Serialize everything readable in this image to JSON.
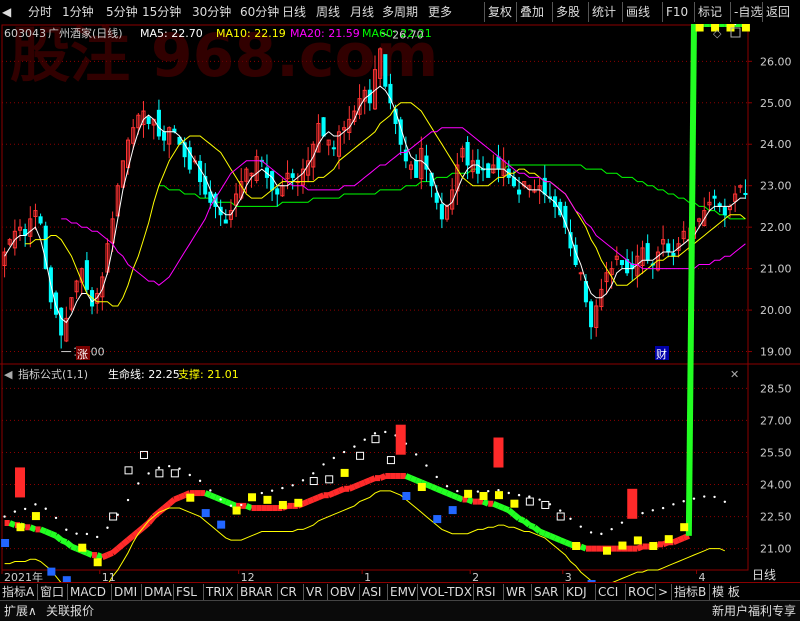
{
  "toolbar": {
    "left": [
      {
        "name": "back",
        "label": "◀"
      },
      {
        "name": "fenshi",
        "label": "分时"
      },
      {
        "name": "1min",
        "label": "1分钟"
      },
      {
        "name": "5min",
        "label": "5分钟"
      },
      {
        "name": "15min",
        "label": "15分钟"
      },
      {
        "name": "30min",
        "label": "30分钟"
      },
      {
        "name": "60min",
        "label": "60分钟"
      },
      {
        "name": "day",
        "label": "日线"
      },
      {
        "name": "week",
        "label": "周线"
      },
      {
        "name": "month",
        "label": "月线"
      },
      {
        "name": "multi",
        "label": "多周期"
      },
      {
        "name": "more",
        "label": "更多"
      }
    ],
    "right": [
      {
        "name": "restore",
        "label": "复权"
      },
      {
        "name": "overlay",
        "label": "叠加"
      },
      {
        "name": "multistock",
        "label": "多股"
      },
      {
        "name": "stats",
        "label": "统计"
      },
      {
        "name": "draw",
        "label": "画线"
      },
      {
        "name": "f10",
        "label": "F10"
      },
      {
        "name": "mark",
        "label": "标记"
      },
      {
        "name": "watch",
        "label": "-自选"
      },
      {
        "name": "return",
        "label": "返回"
      }
    ]
  },
  "watermark": "股注 968.com",
  "stock": {
    "code": "603043",
    "name": "广州酒家(日线)"
  },
  "ma_legend": [
    {
      "label": "MA5: 22.70",
      "color": "#ffffff"
    },
    {
      "label": "MA10: 22.19",
      "color": "#ffff00"
    },
    {
      "label": "MA20: 21.59",
      "color": "#ff00ff"
    },
    {
      "label": "MA60: 22.21",
      "color": "#00ff00"
    }
  ],
  "annotations": {
    "high": "26.70",
    "low": "19.00",
    "zhang": "涨",
    "cai": "财"
  },
  "indicator": {
    "name": "指标公式(1,1)",
    "line1": "生命线: 22.25",
    "line2": "支撑: 21.01"
  },
  "colors": {
    "up": "#ff3333",
    "down": "#00ffff",
    "ma5": "#ffffff",
    "ma10": "#ffff00",
    "ma20": "#ff00ff",
    "ma60": "#00ff00",
    "grid": "#8b0000",
    "axis": "#8b0000"
  },
  "chart_data": [
    {
      "type": "candlestick",
      "title": "603043 广州酒家(日线)",
      "y_ticks": [
        19.0,
        20.0,
        21.0,
        22.0,
        23.0,
        24.0,
        25.0,
        26.0
      ],
      "ylim": [
        18.7,
        26.9
      ],
      "x_labels": [
        "2021年",
        "11",
        "12",
        "1",
        "2",
        "3",
        "4"
      ],
      "x_label_index": [
        0,
        19,
        46,
        70,
        91,
        109,
        135
      ],
      "close": [
        21.4,
        21.7,
        21.9,
        22.0,
        21.8,
        22.2,
        22.4,
        22.1,
        21.0,
        20.2,
        19.9,
        19.4,
        19.8,
        20.3,
        20.7,
        21.0,
        20.5,
        20.1,
        20.4,
        20.8,
        21.6,
        22.2,
        23.0,
        23.6,
        24.1,
        24.4,
        24.7,
        24.8,
        24.5,
        24.6,
        24.2,
        24.1,
        24.4,
        24.3,
        24.0,
        23.7,
        23.4,
        23.6,
        23.1,
        22.8,
        22.6,
        22.5,
        22.3,
        22.1,
        22.4,
        22.8,
        23.1,
        23.4,
        23.3,
        23.7,
        23.6,
        23.2,
        22.9,
        22.8,
        23.0,
        23.3,
        23.2,
        23.1,
        23.4,
        23.6,
        24.0,
        24.5,
        24.2,
        24.1,
        23.9,
        24.3,
        24.4,
        24.6,
        24.8,
        25.1,
        25.3,
        25.0,
        25.8,
        26.3,
        25.4,
        25.0,
        24.5,
        24.0,
        23.6,
        23.5,
        23.2,
        23.9,
        23.4,
        23.0,
        22.6,
        22.2,
        22.5,
        22.9,
        23.5,
        23.9,
        23.5,
        23.6,
        23.3,
        23.4,
        23.2,
        23.5,
        23.4,
        23.6,
        23.2,
        23.0,
        22.8,
        23.1,
        23.0,
        22.9,
        23.0,
        22.8,
        22.7,
        22.5,
        22.3,
        22.0,
        21.5,
        21.1,
        20.9,
        20.2,
        19.6,
        20.1,
        20.5,
        20.9,
        21.0,
        21.3,
        21.1,
        20.9,
        21.0,
        21.3,
        21.5,
        21.2,
        21.1,
        21.4,
        21.7,
        21.4,
        21.3,
        21.6,
        21.9,
        21.7,
        22.0,
        22.2,
        22.4,
        22.6,
        22.7,
        22.5,
        22.3,
        22.5,
        22.8,
        23.0,
        22.8
      ],
      "ma_series": [
        {
          "name": "MA5",
          "values": [
            21.3,
            21.5,
            21.7,
            21.8,
            21.8,
            21.9,
            22.0,
            21.7,
            21.2,
            20.6,
            20.1,
            19.8,
            19.7,
            19.9,
            20.2,
            20.4,
            20.4,
            20.2,
            20.3,
            20.5,
            20.9,
            21.5,
            22.2,
            22.9,
            23.4,
            23.9,
            24.3,
            24.6,
            24.7,
            24.6,
            24.4,
            24.3,
            24.3,
            24.3,
            24.2,
            24.0,
            23.8,
            23.6,
            23.4,
            23.2,
            22.9,
            22.6,
            22.4,
            22.3,
            22.3,
            22.5,
            22.7,
            23.0,
            23.2,
            23.3,
            23.4,
            23.3,
            23.2,
            23.0,
            23.0,
            23.0,
            23.1,
            23.2,
            23.3,
            23.5,
            23.7,
            24.0,
            24.2,
            24.3,
            24.2,
            24.2,
            24.3,
            24.4,
            24.6,
            24.9,
            25.1,
            25.2,
            25.3,
            25.4,
            25.3,
            25.1,
            24.8,
            24.4,
            24.0,
            23.7,
            23.6,
            23.6,
            23.5,
            23.3,
            22.9,
            22.6,
            22.5,
            22.6,
            22.9,
            23.2,
            23.4,
            23.5,
            23.5,
            23.4,
            23.4,
            23.4,
            23.4,
            23.4,
            23.3,
            23.2,
            23.1,
            23.0,
            22.9,
            22.9,
            22.9,
            22.8,
            22.7,
            22.6,
            22.4,
            22.1,
            21.8,
            21.4,
            21.1,
            20.7,
            20.4,
            20.3,
            20.3,
            20.4,
            20.6,
            20.9,
            21.0,
            21.0,
            21.0,
            21.1,
            21.2,
            21.2,
            21.2,
            21.3,
            21.4,
            21.4,
            21.4,
            21.5,
            21.6,
            21.7,
            21.8,
            22.0,
            22.2,
            22.4,
            22.5,
            22.5,
            22.5,
            22.5,
            22.6,
            22.7,
            22.7
          ]
        },
        {
          "name": "MA10",
          "values": [
            21.6,
            21.6,
            21.7,
            21.7,
            21.7,
            21.8,
            21.8,
            21.7,
            21.5,
            21.3,
            21.0,
            20.7,
            20.4,
            20.3,
            20.2,
            20.2,
            20.2,
            20.1,
            20.1,
            20.3,
            20.6,
            21.0,
            21.3,
            21.7,
            22.1,
            22.6,
            23.0,
            23.3,
            23.6,
            23.8,
            24.0,
            24.1,
            24.2,
            24.2,
            24.2,
            24.1,
            24.0,
            23.9,
            23.8,
            23.6,
            23.4,
            23.2,
            23.0,
            22.8,
            22.7,
            22.7,
            22.7,
            22.8,
            22.9,
            23.0,
            23.1,
            23.1,
            23.1,
            23.1,
            23.1,
            23.1,
            23.1,
            23.2,
            23.2,
            23.3,
            23.4,
            23.6,
            23.7,
            23.8,
            23.9,
            24.0,
            24.1,
            24.2,
            24.3,
            24.5,
            24.6,
            24.7,
            24.9,
            25.0,
            25.0,
            25.0,
            24.9,
            24.8,
            24.6,
            24.4,
            24.2,
            24.0,
            23.8,
            23.6,
            23.4,
            23.2,
            23.1,
            23.0,
            23.0,
            23.0,
            23.0,
            23.1,
            23.2,
            23.2,
            23.3,
            23.3,
            23.4,
            23.4,
            23.3,
            23.3,
            23.2,
            23.1,
            23.1,
            23.0,
            22.9,
            22.8,
            22.6,
            22.4,
            22.2,
            22.0,
            21.7,
            21.5,
            21.2,
            21.0,
            20.8,
            20.6,
            20.6,
            20.6,
            20.7,
            20.8,
            20.9,
            21.0,
            21.1,
            21.2,
            21.2,
            21.3,
            21.3,
            21.3,
            21.4,
            21.5,
            21.6,
            21.7,
            21.8,
            21.9,
            22.0,
            22.1,
            22.2,
            22.3,
            22.3,
            22.3,
            22.2
          ]
        },
        {
          "name": "MA20",
          "values": [
            22.2,
            22.2,
            22.1,
            22.1,
            22.0,
            22.0,
            21.9,
            21.9,
            21.8,
            21.7,
            21.6,
            21.4,
            21.3,
            21.1,
            21.0,
            20.9,
            20.8,
            20.7,
            20.7,
            20.6,
            20.7,
            20.8,
            21.0,
            21.2,
            21.4,
            21.6,
            21.8,
            22.0,
            22.2,
            22.5,
            22.7,
            22.9,
            23.1,
            23.3,
            23.4,
            23.5,
            23.6,
            23.6,
            23.6,
            23.6,
            23.5,
            23.4,
            23.3,
            23.2,
            23.1,
            23.0,
            23.0,
            23.0,
            22.9,
            22.9,
            22.9,
            22.9,
            22.9,
            22.9,
            22.9,
            23.0,
            23.0,
            23.0,
            23.1,
            23.2,
            23.3,
            23.4,
            23.5,
            23.5,
            23.6,
            23.7,
            23.8,
            23.8,
            23.9,
            24.0,
            24.1,
            24.2,
            24.3,
            24.3,
            24.4,
            24.4,
            24.4,
            24.4,
            24.4,
            24.3,
            24.2,
            24.1,
            24.0,
            23.9,
            23.8,
            23.7,
            23.6,
            23.5,
            23.4,
            23.3,
            23.3,
            23.2,
            23.2,
            23.2,
            23.1,
            23.1,
            23.0,
            22.9,
            22.8,
            22.6,
            22.4,
            22.3,
            22.1,
            22.0,
            21.8,
            21.7,
            21.6,
            21.5,
            21.4,
            21.3,
            21.2,
            21.1,
            21.1,
            21.0,
            21.0,
            21.0,
            21.0,
            21.0,
            21.0,
            21.0,
            21.0,
            21.0,
            21.0,
            21.0,
            21.1,
            21.1,
            21.1,
            21.2,
            21.2,
            21.3,
            21.3,
            21.4,
            21.5,
            21.6
          ]
        },
        {
          "name": "MA60",
          "values": [
            23.0,
            23.0,
            22.9,
            22.9,
            22.9,
            22.8,
            22.8,
            22.8,
            22.7,
            22.7,
            22.7,
            22.6,
            22.6,
            22.6,
            22.6,
            22.5,
            22.5,
            22.5,
            22.5,
            22.5,
            22.5,
            22.5,
            22.5,
            22.5,
            22.6,
            22.6,
            22.6,
            22.6,
            22.6,
            22.6,
            22.7,
            22.7,
            22.7,
            22.7,
            22.7,
            22.7,
            22.8,
            22.8,
            22.8,
            22.8,
            22.8,
            22.8,
            22.8,
            22.9,
            22.9,
            22.9,
            22.9,
            22.9,
            23.0,
            23.0,
            23.0,
            23.1,
            23.1,
            23.1,
            23.2,
            23.2,
            23.2,
            23.3,
            23.3,
            23.3,
            23.3,
            23.4,
            23.4,
            23.4,
            23.4,
            23.4,
            23.4,
            23.4,
            23.5,
            23.5,
            23.5,
            23.5,
            23.5,
            23.5,
            23.5,
            23.5,
            23.5,
            23.5,
            23.5,
            23.5,
            23.5,
            23.5,
            23.5,
            23.4,
            23.4,
            23.4,
            23.4,
            23.3,
            23.3,
            23.3,
            23.2,
            23.2,
            23.2,
            23.1,
            23.1,
            23.0,
            23.0,
            22.9,
            22.9,
            22.8,
            22.8,
            22.7,
            22.7,
            22.6,
            22.6,
            22.5,
            22.5,
            22.4,
            22.4,
            22.3,
            22.3,
            22.2,
            22.2,
            22.2,
            22.2
          ]
        }
      ]
    },
    {
      "type": "line",
      "title": "指标公式(1,1)",
      "y_ticks": [
        21.0,
        22.5,
        24.0,
        25.5,
        27.0,
        28.5
      ],
      "ylim": [
        20.0,
        29.5
      ],
      "series": [
        {
          "name": "生命线",
          "values": [
            22.25
          ]
        },
        {
          "name": "支撑",
          "values": [
            21.01
          ]
        }
      ]
    }
  ],
  "bottom_tabs": [
    "指标A",
    "窗口",
    "MACD",
    "DMI",
    "DMA",
    "FSL",
    "TRIX",
    "BRAR",
    "CR",
    "VR",
    "OBV",
    "ASI",
    "EMV",
    "VOL-TDX",
    "RSI",
    "WR",
    "SAR",
    "KDJ",
    "CCI",
    "ROC",
    ">",
    "指标B",
    "模 板"
  ],
  "status": {
    "left": "扩展∧",
    "left2": "关联报价",
    "right": "新用户福利专享"
  },
  "side_tabs": {
    "day": "日线"
  }
}
